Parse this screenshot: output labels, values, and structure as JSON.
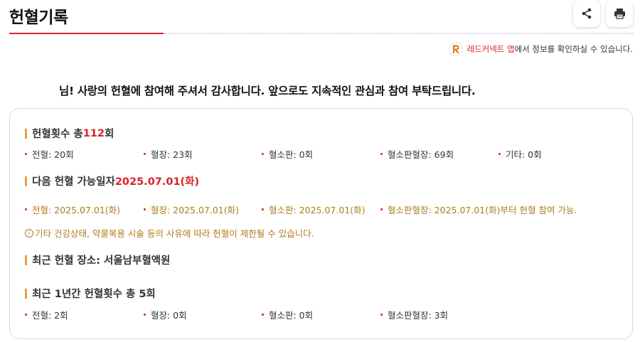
{
  "header": {
    "title": "헌혈기록",
    "share_icon": "share-icon",
    "print_icon": "print-icon"
  },
  "app_note": {
    "app_name": "레드커넥트 앱",
    "text": "에서 정보를 확인하실 수 있습니다."
  },
  "thanks_message": "님! 사랑의 헌혈에 참여해 주셔서 감사합니다. 앞으로도 지속적인 관심과 참여 부탁드립니다.",
  "total": {
    "label": "헌혈횟수 총 ",
    "count": "112",
    "unit": "회",
    "items": [
      {
        "label": "전혈: 20회"
      },
      {
        "label": "혈장: 23회"
      },
      {
        "label": "혈소판: 0회"
      },
      {
        "label": "혈소판혈장: 69회"
      },
      {
        "label": "기타: 0회"
      }
    ]
  },
  "next": {
    "label": "다음 헌혈 가능일자 ",
    "date": "2025.07.01(화)",
    "items": [
      {
        "label": "전혈: 2025.07.01(화)"
      },
      {
        "label": "혈장: 2025.07.01(화)"
      },
      {
        "label": "혈소판: 2025.07.01(화)"
      },
      {
        "label": "혈소판혈장: 2025.07.01(화)부터 헌혈 참여 가능."
      }
    ],
    "notice": "기타 건강상태, 약물복용 시술 등의 사유에 따라 헌혈이 제한될 수 있습니다."
  },
  "recent_place": {
    "label": "최근 헌혈 장소: 서울남부혈액원"
  },
  "recent_year": {
    "label": "최근 1년간 헌혈횟수 총 5회",
    "items": [
      {
        "label": "전혈: 2회"
      },
      {
        "label": "혈장: 0회"
      },
      {
        "label": "혈소판: 0회"
      },
      {
        "label": "혈소판혈장: 3회"
      }
    ]
  },
  "colors": {
    "accent_red": "#d8232a",
    "accent_gold": "#b07a1c",
    "bar_orange": "#e8a23a"
  }
}
